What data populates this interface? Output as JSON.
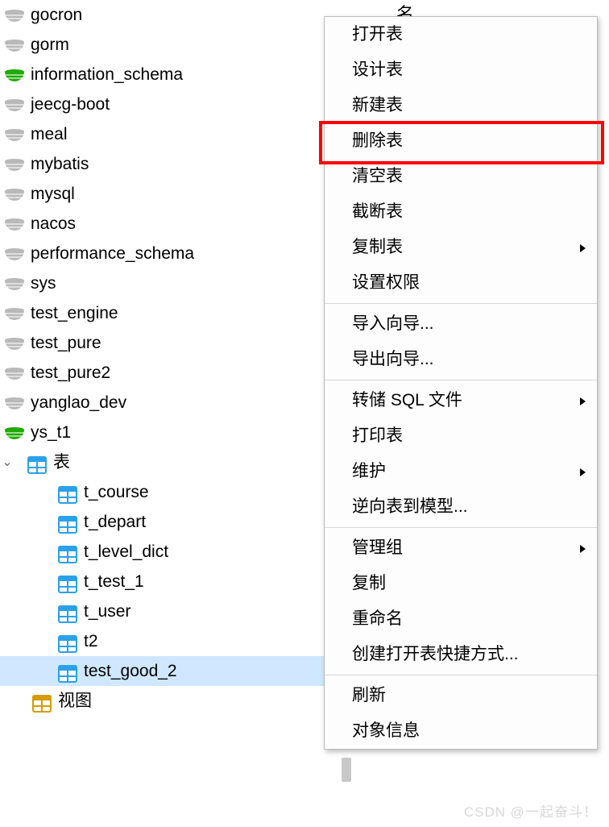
{
  "header": {
    "col_name": "名"
  },
  "databases": [
    {
      "name": "gocron",
      "active": false
    },
    {
      "name": "gorm",
      "active": false
    },
    {
      "name": "information_schema",
      "active": true
    },
    {
      "name": "jeecg-boot",
      "active": false
    },
    {
      "name": "meal",
      "active": false
    },
    {
      "name": "mybatis",
      "active": false
    },
    {
      "name": "mysql",
      "active": false
    },
    {
      "name": "nacos",
      "active": false
    },
    {
      "name": "performance_schema",
      "active": false
    },
    {
      "name": "sys",
      "active": false
    },
    {
      "name": "test_engine",
      "active": false
    },
    {
      "name": "test_pure",
      "active": false
    },
    {
      "name": "test_pure2",
      "active": false
    },
    {
      "name": "yanglao_dev",
      "active": false
    },
    {
      "name": "ys_t1",
      "active": true
    }
  ],
  "tables_group_label": "表",
  "tables": [
    {
      "name": "t_course",
      "selected": false
    },
    {
      "name": "t_depart",
      "selected": false
    },
    {
      "name": "t_level_dict",
      "selected": false
    },
    {
      "name": "t_test_1",
      "selected": false
    },
    {
      "name": "t_user",
      "selected": false
    },
    {
      "name": "t2",
      "selected": false
    },
    {
      "name": "test_good_2",
      "selected": true
    }
  ],
  "views_label": "视图",
  "context_menu": {
    "groups": [
      [
        {
          "label": "打开表",
          "submenu": false,
          "highlight": false
        },
        {
          "label": "设计表",
          "submenu": false,
          "highlight": false
        },
        {
          "label": "新建表",
          "submenu": false,
          "highlight": false
        },
        {
          "label": "删除表",
          "submenu": false,
          "highlight": true
        },
        {
          "label": "清空表",
          "submenu": false,
          "highlight": false
        },
        {
          "label": "截断表",
          "submenu": false,
          "highlight": false
        },
        {
          "label": "复制表",
          "submenu": true,
          "highlight": false
        },
        {
          "label": "设置权限",
          "submenu": false,
          "highlight": false
        }
      ],
      [
        {
          "label": "导入向导...",
          "submenu": false,
          "highlight": false
        },
        {
          "label": "导出向导...",
          "submenu": false,
          "highlight": false
        }
      ],
      [
        {
          "label": "转储 SQL 文件",
          "submenu": true,
          "highlight": false
        },
        {
          "label": "打印表",
          "submenu": false,
          "highlight": false
        },
        {
          "label": "维护",
          "submenu": true,
          "highlight": false
        },
        {
          "label": "逆向表到模型...",
          "submenu": false,
          "highlight": false
        }
      ],
      [
        {
          "label": "管理组",
          "submenu": true,
          "highlight": false
        },
        {
          "label": "复制",
          "submenu": false,
          "highlight": false
        },
        {
          "label": "重命名",
          "submenu": false,
          "highlight": false
        },
        {
          "label": "创建打开表快捷方式...",
          "submenu": false,
          "highlight": false
        }
      ],
      [
        {
          "label": "刷新",
          "submenu": false,
          "highlight": false
        },
        {
          "label": "对象信息",
          "submenu": false,
          "highlight": false
        }
      ]
    ]
  },
  "watermark": "CSDN @一起奋斗！"
}
